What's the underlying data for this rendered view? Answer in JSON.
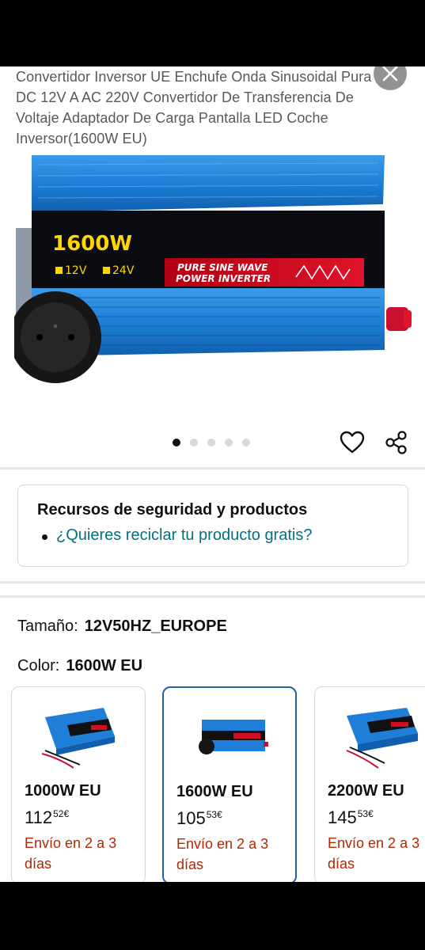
{
  "product": {
    "title": "Convertidor Inversor UE Enchufe Onda Sinusoidal Pura DC 12V A AC 220V Convertidor De Transferencia De Voltaje Adaptador De Carga Pantalla LED Coche Inversor(1600W EU)"
  },
  "image": {
    "wattage": "1600W",
    "v12": "12V",
    "v24": "24V",
    "banner_line1": "PURE SINE WAVE",
    "banner_line2": "POWER INVERTER"
  },
  "carousel": {
    "count": 5,
    "active_index": 0
  },
  "icons": {
    "close": "close-icon",
    "wishlist": "heart-icon",
    "share": "share-icon"
  },
  "safety": {
    "title": "Recursos de seguridad y productos",
    "link": "¿Quieres reciclar tu producto gratis?"
  },
  "size": {
    "label": "Tamaño:",
    "value": "12V50HZ_EUROPE"
  },
  "color": {
    "label": "Color:",
    "value": "1600W EU"
  },
  "variants": [
    {
      "name": "1000W EU",
      "price_whole": "112",
      "price_cents": "52",
      "currency": "€",
      "shipping": "Envío en 2 a 3 días",
      "selected": false
    },
    {
      "name": "1600W EU",
      "price_whole": "105",
      "price_cents": "53",
      "currency": "€",
      "shipping": "Envío en 2 a 3 días",
      "selected": true
    },
    {
      "name": "2200W EU",
      "price_whole": "145",
      "price_cents": "53",
      "currency": "€",
      "shipping": "Envío en 2 a 3 días",
      "selected": false
    }
  ],
  "colors": {
    "link": "#007185",
    "shipping": "#b12704",
    "selected_border": "#2162a1",
    "inverter_blue": "#1f7fd8"
  }
}
